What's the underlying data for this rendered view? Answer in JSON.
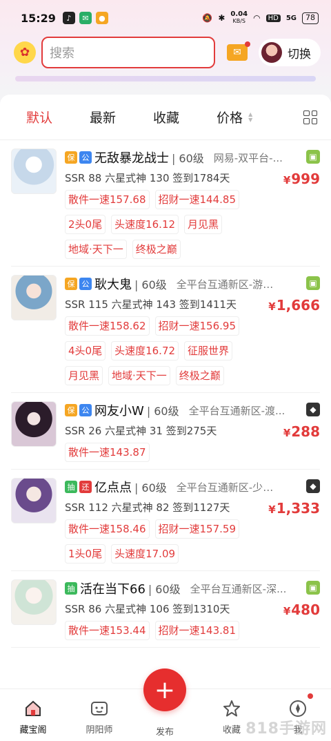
{
  "status": {
    "time": "15:29",
    "net_speed_value": "0.04",
    "net_speed_unit": "KB/S",
    "hd": "HD",
    "signal": "5G",
    "battery": "78"
  },
  "header": {
    "search_placeholder": "搜索",
    "switch_label": "切换"
  },
  "tabs": {
    "default": "默认",
    "latest": "最新",
    "favorite": "收藏",
    "price": "价格"
  },
  "items": [
    {
      "tags": [
        "保",
        "公"
      ],
      "name": "无敌暴龙战士",
      "level": "60级",
      "server": "网易-双平台-...",
      "platform": "android",
      "desc": "SSR 88 六星式神 130 签到1784天",
      "price": "999",
      "chips": [
        "散件一速157.68",
        "招财一速144.85",
        "2头0尾",
        "头速度16.12",
        "月见黑",
        "地域·天下一",
        "终极之巅"
      ]
    },
    {
      "tags": [
        "保",
        "公"
      ],
      "name": "耿大鬼",
      "level": "60级",
      "server": "全平台互通新区-游梦...",
      "platform": "android",
      "desc": "SSR 115 六星式神 143 签到1411天",
      "price": "1,666",
      "chips": [
        "散件一速158.62",
        "招财一速156.95",
        "4头0尾",
        "头速度16.72",
        "征服世界",
        "月见黑",
        "地域·天下一",
        "终极之巅"
      ]
    },
    {
      "tags": [
        "保",
        "公"
      ],
      "name": "网友小W",
      "level": "60级",
      "server": "全平台互通新区-渡...",
      "platform": "ios",
      "desc": "SSR 26 六星式神 31 签到275天",
      "price": "288",
      "chips": [
        "散件一速143.87"
      ]
    },
    {
      "tags": [
        "抽",
        "还"
      ],
      "name": "亿点点",
      "level": "60级",
      "server": "全平台互通新区-少时...",
      "platform": "ios",
      "desc": "SSR 112 六星式神 82 签到1127天",
      "price": "1,333",
      "chips": [
        "散件一速158.46",
        "招财一速157.59",
        "1头0尾",
        "头速度17.09"
      ]
    },
    {
      "tags": [
        "抽"
      ],
      "name": "活在当下66",
      "level": "60级",
      "server": "全平台互通新区-深...",
      "platform": "android",
      "desc": "SSR 86 六星式神 106 签到1310天",
      "price": "480",
      "chips": [
        "散件一速153.44",
        "招财一速143.81"
      ]
    }
  ],
  "currency": "¥",
  "bottom_nav": {
    "home": "藏宝阁",
    "onmyoji": "阴阳师",
    "publish": "发布",
    "favorites": "收藏",
    "me": "我"
  },
  "watermark": "818手游网"
}
